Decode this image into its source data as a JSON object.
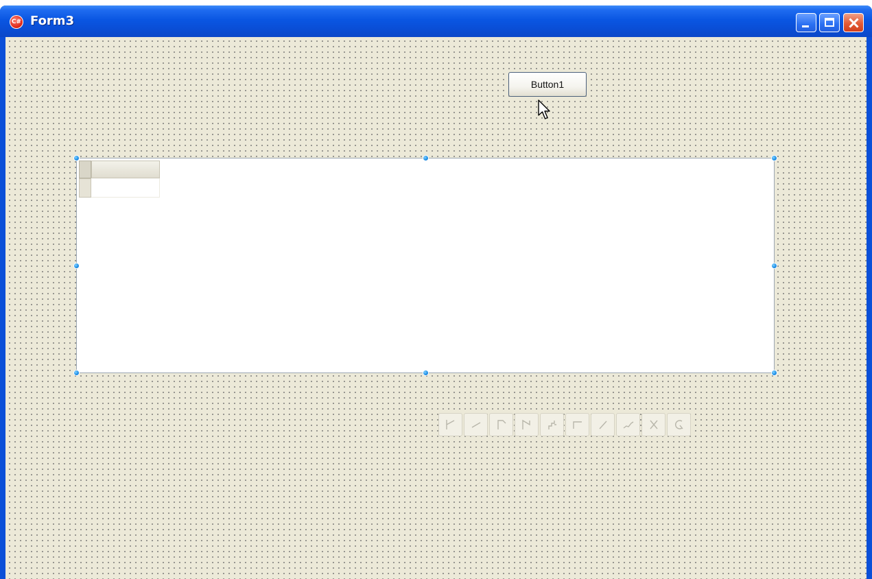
{
  "window": {
    "title": "Form3",
    "app_icon_text": "C#",
    "titlebar_color": "#0a4fd8",
    "client_color": "#ece9d8"
  },
  "form": {
    "button1_label": "Button1",
    "selection_handle_color": "#1d8ee6"
  },
  "toolstrip": {
    "icons": [
      "line-start-icon",
      "line-segment-icon",
      "corner-line-icon",
      "polyline-icon",
      "step-line-icon",
      "horizontal-line-icon",
      "diagonal-line-icon",
      "curve-line-icon",
      "cross-line-icon",
      "arc-icon"
    ]
  }
}
